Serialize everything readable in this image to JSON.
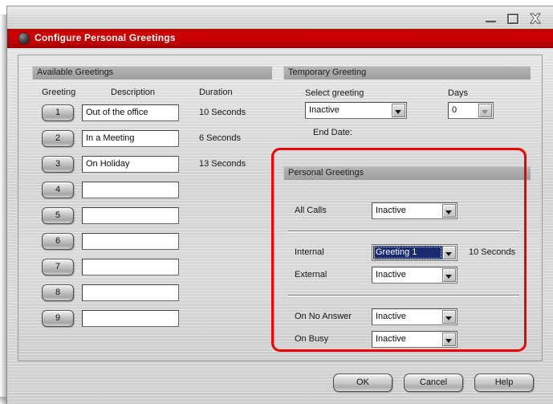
{
  "window": {
    "title": "Configure Personal Greetings",
    "app_icon": "dot-icon",
    "controls": {
      "minimize": "minimize-icon",
      "maximize": "maximize-icon",
      "close": "close-icon"
    },
    "colors": {
      "titlebar_red": "#c00000",
      "selection_navy": "#1a2a6e",
      "annotation_red": "#f20000",
      "panel_gray": "#d2d2d2",
      "group_header_gray": "#a9a9a9"
    }
  },
  "available_greetings": {
    "group_title": "Available Greetings",
    "columns": [
      "Greeting",
      "Description",
      "Duration"
    ],
    "rows": [
      {
        "num": "1",
        "description": "Out of the office",
        "duration": "10 Seconds"
      },
      {
        "num": "2",
        "description": "In a Meeting",
        "duration": "6 Seconds"
      },
      {
        "num": "3",
        "description": "On Holiday",
        "duration": "13 Seconds"
      },
      {
        "num": "4",
        "description": "",
        "duration": ""
      },
      {
        "num": "5",
        "description": "",
        "duration": ""
      },
      {
        "num": "6",
        "description": "",
        "duration": ""
      },
      {
        "num": "7",
        "description": "",
        "duration": ""
      },
      {
        "num": "8",
        "description": "",
        "duration": ""
      },
      {
        "num": "9",
        "description": "",
        "duration": ""
      }
    ]
  },
  "temporary_greeting": {
    "group_title": "Temporary Greeting",
    "select_greeting_label": "Select greeting",
    "select_greeting_value": "Inactive",
    "days_label": "Days",
    "days_value": "0",
    "days_enabled": false,
    "end_date_label": "End Date:",
    "end_date_value": ""
  },
  "personal_greetings": {
    "group_title": "Personal Greetings",
    "fields": [
      {
        "label": "All Calls",
        "value": "Inactive",
        "duration": "",
        "selected": false
      },
      {
        "label": "Internal",
        "value": "Greeting 1",
        "duration": "10 Seconds",
        "selected": true
      },
      {
        "label": "External",
        "value": "Inactive",
        "duration": "",
        "selected": false
      },
      {
        "label": "On No Answer",
        "value": "Inactive",
        "duration": "",
        "selected": false
      },
      {
        "label": "On Busy",
        "value": "Inactive",
        "duration": "",
        "selected": false
      }
    ]
  },
  "footer": {
    "ok_label": "OK",
    "cancel_label": "Cancel",
    "help_label": "Help"
  }
}
